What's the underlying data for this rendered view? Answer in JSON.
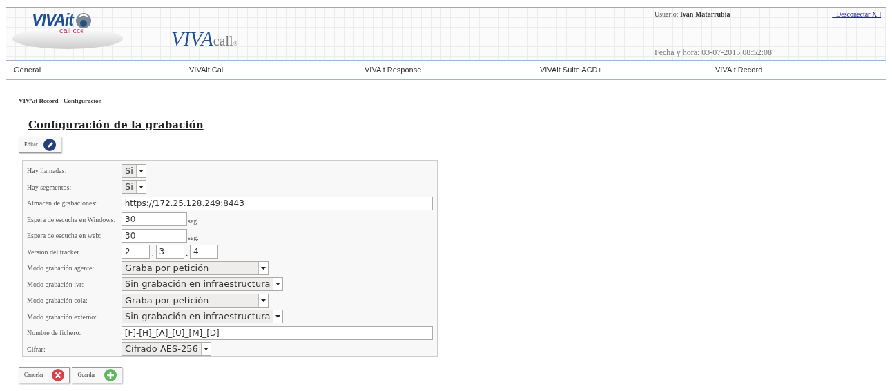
{
  "header": {
    "logo": {
      "brand": "VIVAit",
      "sub": "call cc",
      "mark": "®"
    },
    "product": {
      "bold": "VIVA",
      "rest": "call",
      "mark": "®"
    },
    "user_label": "Usuario:",
    "user_name": "Ivan Matarrubia",
    "logout": "[ Desconectar X ]",
    "datetime": "Fecha y hora: 03-07-2015 08:52:08"
  },
  "nav": [
    {
      "label": "General"
    },
    {
      "label": "VIVAit Call"
    },
    {
      "label": "VIVAit Response"
    },
    {
      "label": "VIVAit Suite ACD+"
    },
    {
      "label": "VIVAit Record"
    }
  ],
  "breadcrumb": "VIVAit Record - Configuración",
  "title": "Configuración de la grabación",
  "edit_button": "Editar",
  "fields": [
    {
      "kind": "select",
      "label": "Hay llamadas:",
      "value": "Si"
    },
    {
      "kind": "select",
      "label": "Hay segmentos:",
      "value": "Si"
    },
    {
      "kind": "text",
      "label": "Almacén de grabaciones:",
      "value": "https://172.25.128.249:8443"
    },
    {
      "kind": "number",
      "label": "Espera de escucha en Windows:",
      "value": "30",
      "unit": "seg."
    },
    {
      "kind": "number",
      "label": "Espera de escucha en web:",
      "value": "30",
      "unit": "seg."
    },
    {
      "kind": "version",
      "label": "Versión del tracker",
      "parts": [
        "2",
        "3",
        "4"
      ],
      "separators": [
        ".",
        "."
      ]
    },
    {
      "kind": "select_wide",
      "label": "Modo grabación agente:",
      "value": "Graba por petición"
    },
    {
      "kind": "select_wide",
      "label": "Modo grabación ivr:",
      "value": "Sin grabación en infraestructura"
    },
    {
      "kind": "select_wide",
      "label": "Modo grabación cola:",
      "value": "Graba por petición"
    },
    {
      "kind": "select_wide",
      "label": "Modo grabación externo:",
      "value": "Sin grabación en infraestructura"
    },
    {
      "kind": "text",
      "label": "Nombre de fichero:",
      "value": "[F]-[H]_[A]_[U]_[M]_[D]"
    },
    {
      "kind": "select",
      "label": "Cifrar:",
      "value": "Cifrado AES-256"
    }
  ],
  "actions": [
    {
      "kind": "cancel",
      "label": "Cancelar"
    },
    {
      "kind": "save",
      "label": "Guardar"
    }
  ]
}
